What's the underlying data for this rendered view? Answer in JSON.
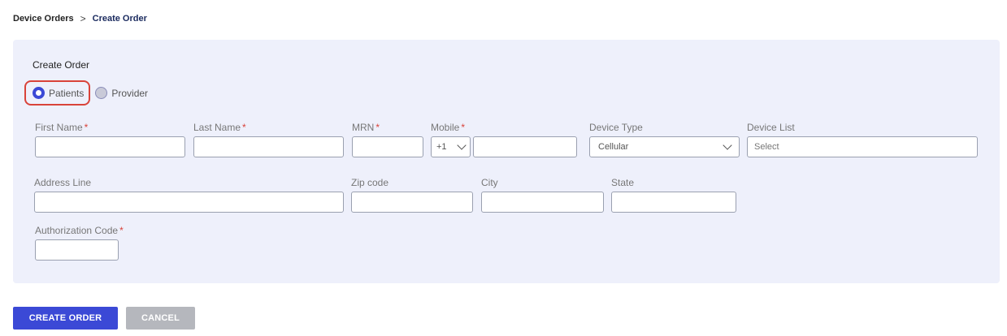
{
  "breadcrumb": {
    "parent": "Device Orders",
    "separator": ">",
    "current": "Create Order"
  },
  "form": {
    "title": "Create Order",
    "recipient_type": {
      "options": [
        "Patients",
        "Provider"
      ],
      "selected": "Patients"
    },
    "fields": {
      "first_name": {
        "label": "First Name",
        "required": "*",
        "value": ""
      },
      "last_name": {
        "label": "Last Name",
        "required": "*",
        "value": ""
      },
      "mrn": {
        "label": "MRN",
        "required": "*",
        "value": ""
      },
      "mobile": {
        "label": "Mobile",
        "required": "*",
        "country_code": "+1",
        "value": ""
      },
      "device_type": {
        "label": "Device Type",
        "value": "Cellular"
      },
      "device_list": {
        "label": "Device List",
        "placeholder": "Select"
      },
      "address_line": {
        "label": "Address Line",
        "value": ""
      },
      "zip_code": {
        "label": "Zip code",
        "value": ""
      },
      "city": {
        "label": "City",
        "value": ""
      },
      "state": {
        "label": "State",
        "value": ""
      },
      "authorization_code": {
        "label": "Authorization Code",
        "required": "*",
        "value": ""
      }
    }
  },
  "actions": {
    "create_label": "CREATE ORDER",
    "cancel_label": "CANCEL"
  },
  "colors": {
    "primary": "#3b49d6",
    "panel_bg": "#eef0fb",
    "required": "#d9433a",
    "highlight": "#d9433a",
    "secondary_button": "#b5b7bd"
  }
}
